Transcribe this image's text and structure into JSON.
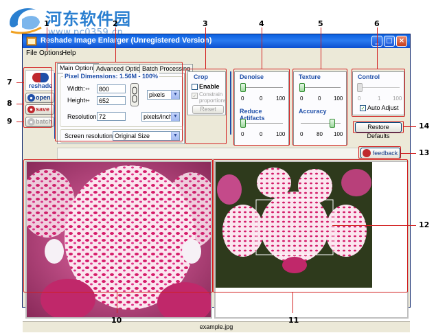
{
  "watermark": {
    "title": "河东软件园",
    "url": "www.pc0359.cn"
  },
  "window": {
    "title": "Reshade Image Enlarger (Unregistered Version)",
    "controls": {
      "minimize": "_",
      "maximize": "□",
      "close": "×"
    }
  },
  "menu": [
    "File",
    "Options",
    "Help"
  ],
  "sidebar": {
    "logo_text": "reshade",
    "open_label": "open",
    "save_label": "save",
    "batch_label": "batch"
  },
  "tabs": [
    "Main Options",
    "Advanced Options",
    "Batch Processing"
  ],
  "main_options": {
    "pixel_dimensions_label": "Pixel Dimensions: 1.56M - 100%",
    "width_label": "Width:",
    "width_value": "800",
    "height_label": "Height:",
    "height_value": "652",
    "unit_select": "pixels",
    "resolution_label": "Resolution",
    "resolution_value": "72",
    "resolution_unit": "pixels/inch",
    "screen_resolution_label": "Screen resolution",
    "screen_resolution_value": "Original Size"
  },
  "crop": {
    "title": "Crop",
    "enable_label": "Enable",
    "enable_checked": false,
    "constrain_label": "Constrain proportions",
    "constrain_checked": true,
    "reset_label": "Reset"
  },
  "denoise": {
    "title": "Denoise",
    "ticks": [
      "0",
      "0",
      "100"
    ],
    "level": 0
  },
  "reduce_artifacts": {
    "title": "Reduce Artifacts",
    "ticks": [
      "0",
      "0",
      "100"
    ],
    "level": 0
  },
  "texture": {
    "title": "Texture",
    "ticks": [
      "0",
      "0",
      "100"
    ],
    "level": 0
  },
  "accuracy": {
    "title": "Accuracy",
    "ticks": [
      "0",
      "80",
      "100"
    ],
    "level": 80
  },
  "control": {
    "title": "Control",
    "ticks": [
      "0",
      "1",
      "100"
    ],
    "level": 0,
    "auto_adjust_label": "Auto Adjust",
    "auto_adjust_checked": true
  },
  "restore_defaults_label": "Restore Defaults",
  "feedback_label": "feedback",
  "status": {
    "filename": "example.jpg"
  },
  "callouts": [
    "1",
    "2",
    "3",
    "4",
    "5",
    "6",
    "7",
    "8",
    "9",
    "10",
    "11",
    "12",
    "13",
    "14"
  ],
  "colors": {
    "accent": "#1f4fa8",
    "callout_red": "#d21e1e",
    "titlebar": "#0a5fe0"
  }
}
